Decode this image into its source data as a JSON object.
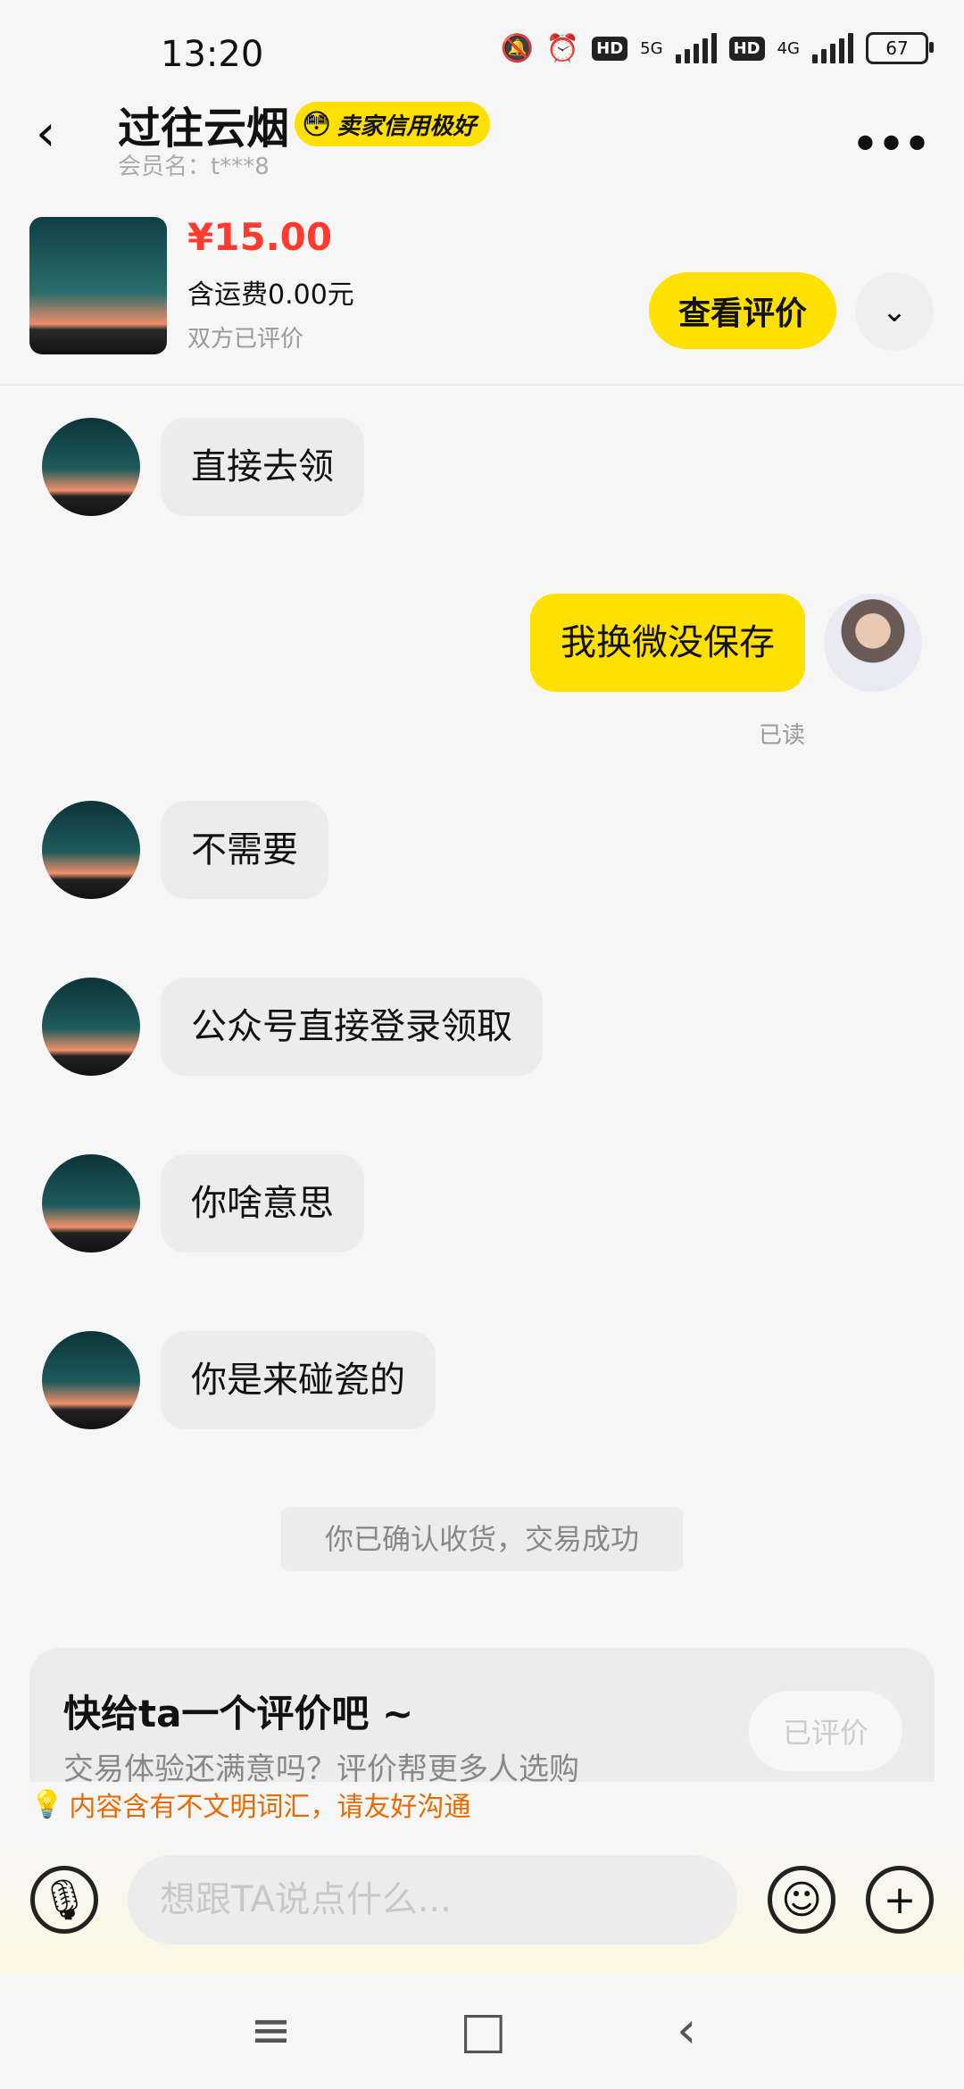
{
  "status_bar": {
    "time": "13:20",
    "net1": "5G",
    "net2": "4G",
    "hd": "HD",
    "battery": "67"
  },
  "header": {
    "title": "过往云烟",
    "badge": "卖家信用极好",
    "member": "会员名：t***8"
  },
  "product": {
    "price": "¥15.00",
    "shipping": "含运费0.00元",
    "status": "双方已评价",
    "review_button": "查看评价"
  },
  "messages": [
    {
      "side": "left",
      "text": "直接去领"
    },
    {
      "side": "right",
      "text": "我换微没保存",
      "read": "已读"
    },
    {
      "side": "left",
      "text": "不需要"
    },
    {
      "side": "left",
      "text": "公众号直接登录领取"
    },
    {
      "side": "left",
      "text": "你啥意思"
    },
    {
      "side": "left",
      "text": "你是来碰瓷的"
    }
  ],
  "system_message": "你已确认收货，交易成功",
  "review_card": {
    "title": "快给ta一个评价吧 ~",
    "subtitle": "交易体验还满意吗？评价帮更多人选购",
    "button": "已评价"
  },
  "warning": "内容含有不文明词汇，请友好沟通",
  "input": {
    "placeholder": "想跟TA说点什么..."
  }
}
